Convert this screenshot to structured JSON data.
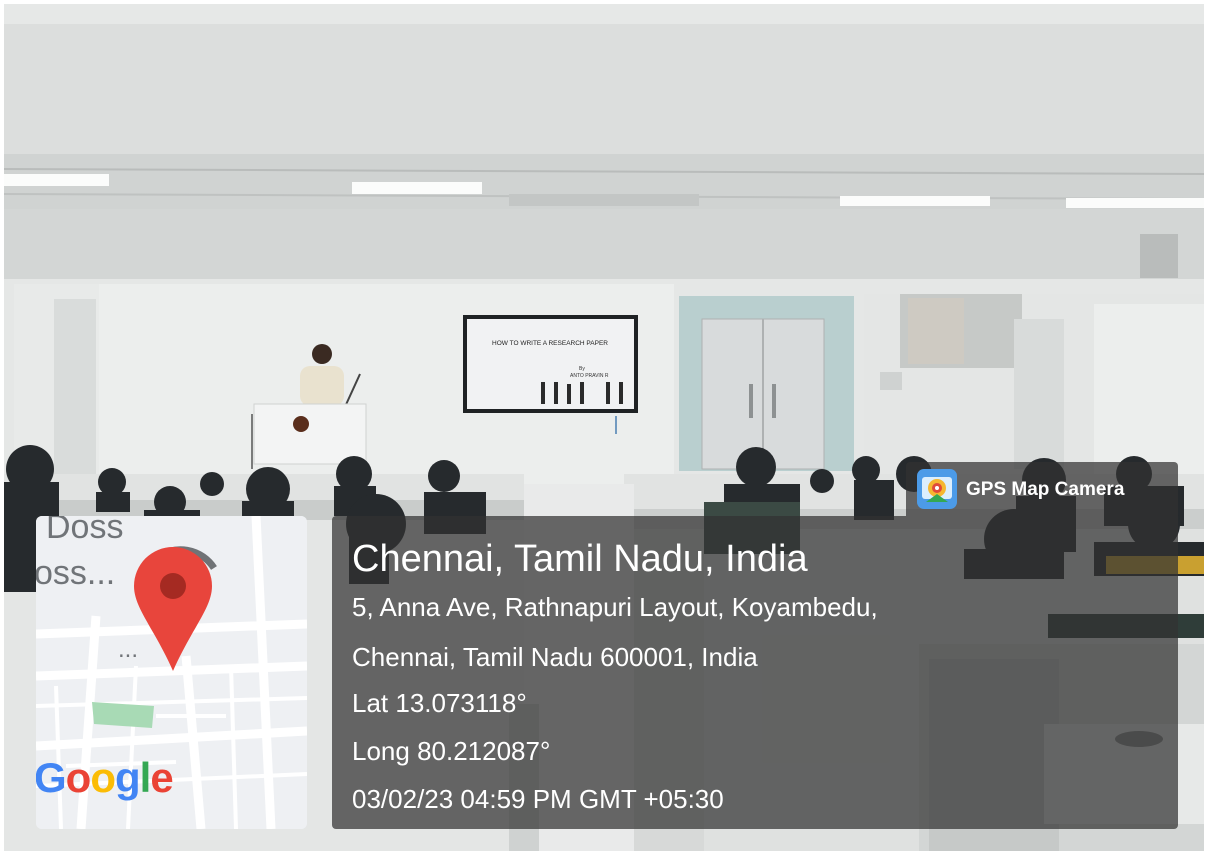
{
  "photo": {
    "slide_title": "HOW TO WRITE A RESEARCH PAPER",
    "slide_by": "By",
    "slide_author": "ANTO PRAVIN R"
  },
  "overlay": {
    "app_badge": "GPS Map Camera",
    "location_title": "Chennai, Tamil Nadu, India",
    "address_line1": "5, Anna Ave, Rathnapuri Layout, Koyambedu,",
    "address_line2": "Chennai, Tamil Nadu 600001, India",
    "latitude": "Lat 13.073118°",
    "longitude": "Long 80.212087°",
    "timestamp": "03/02/23 04:59 PM GMT +05:30"
  },
  "map": {
    "label_top": "Doss",
    "label_second": "oss...",
    "label_dots": "...",
    "logo": {
      "G": "G",
      "o1": "o",
      "o2": "o",
      "g": "g",
      "l": "l",
      "e": "e"
    },
    "colors": {
      "pin": "#e8453c",
      "park": "#a8dab5",
      "blue": "#4285f4",
      "red": "#ea4335",
      "yellow": "#fbbc05",
      "green": "#34a853"
    }
  }
}
